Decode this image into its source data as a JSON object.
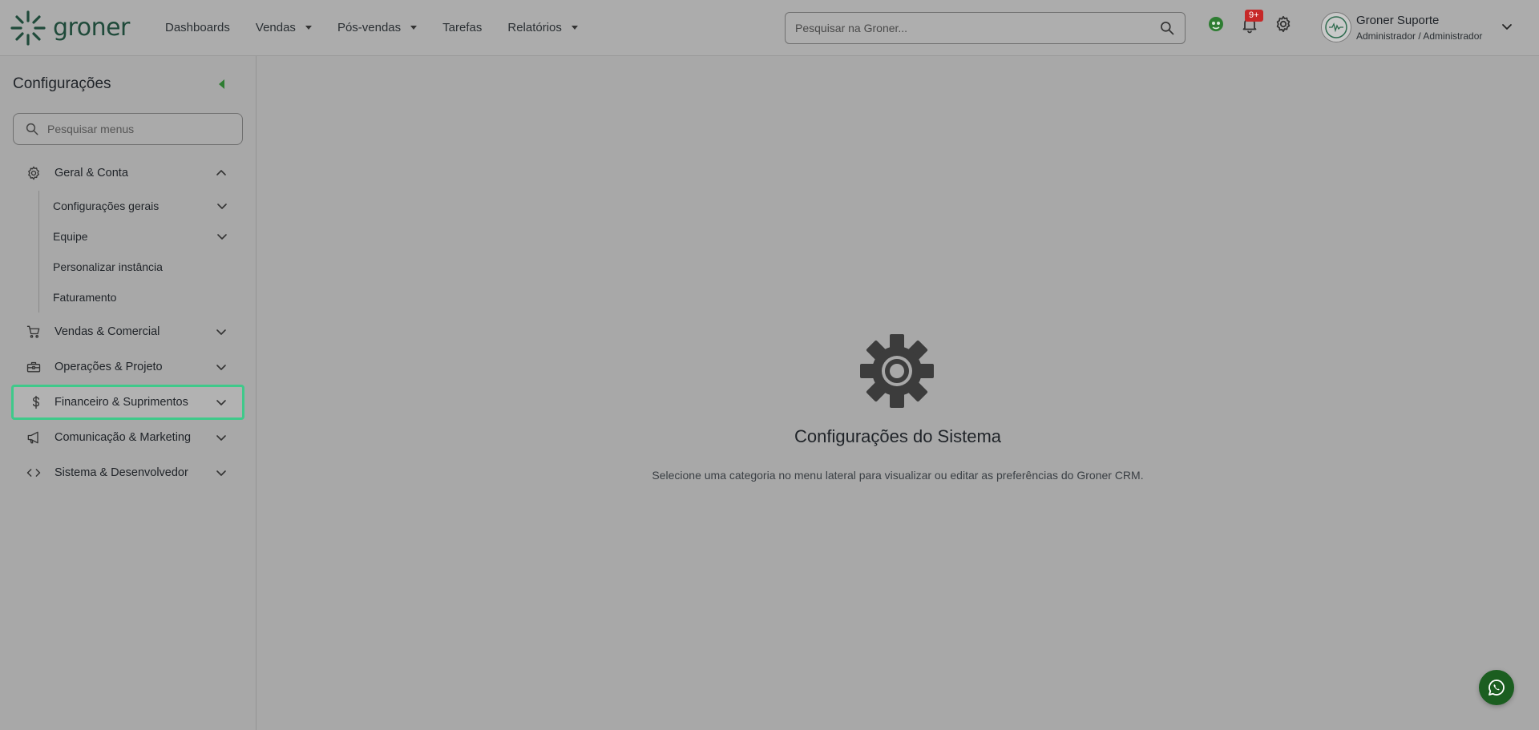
{
  "app": {
    "brand_name": "groner",
    "accent": "#2e7d32",
    "highlight": "#3fc98a"
  },
  "header": {
    "nav": [
      {
        "label": "Dashboards",
        "has_dropdown": false
      },
      {
        "label": "Vendas",
        "has_dropdown": true
      },
      {
        "label": "Pós-vendas",
        "has_dropdown": true
      },
      {
        "label": "Tarefas",
        "has_dropdown": false
      },
      {
        "label": "Relatórios",
        "has_dropdown": true
      }
    ],
    "search_placeholder": "Pesquisar na Groner...",
    "notifications_badge": "9+",
    "user": {
      "name": "Groner Suporte",
      "role": "Administrador / Administrador"
    }
  },
  "sidebar": {
    "title": "Configurações",
    "search_placeholder": "Pesquisar menus",
    "groups": [
      {
        "label": "Geral & Conta",
        "icon": "gear-icon",
        "expanded": true,
        "children": [
          {
            "label": "Configurações gerais",
            "has_children": true
          },
          {
            "label": "Equipe",
            "has_children": true
          },
          {
            "label": "Personalizar instância",
            "has_children": false
          },
          {
            "label": "Faturamento",
            "has_children": false
          }
        ]
      },
      {
        "label": "Vendas & Comercial",
        "icon": "cart-icon"
      },
      {
        "label": "Operações & Projeto",
        "icon": "toolbox-icon"
      },
      {
        "label": "Financeiro & Suprimentos",
        "icon": "dollar-icon",
        "active": true
      },
      {
        "label": "Comunicação & Marketing",
        "icon": "megaphone-icon"
      },
      {
        "label": "Sistema & Desenvolvedor",
        "icon": "code-icon"
      }
    ]
  },
  "main": {
    "empty_title": "Configurações do Sistema",
    "empty_description": "Selecione uma categoria no menu lateral para visualizar ou editar as preferências do Groner CRM."
  }
}
